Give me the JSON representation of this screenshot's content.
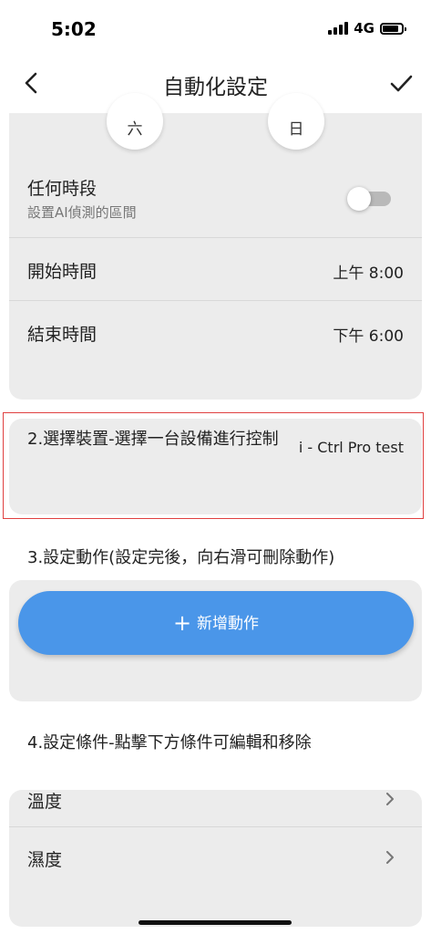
{
  "status_bar": {
    "time": "5:02",
    "network": "4G"
  },
  "nav": {
    "title": "自動化設定"
  },
  "days": {
    "sat": "六",
    "sun": "日"
  },
  "schedule": {
    "any_time_title": "任何時段",
    "any_time_subtitle": "設置AI偵測的區間",
    "any_time_enabled": false,
    "start_label": "開始時間",
    "start_value": "上午 8:00",
    "end_label": "結束時間",
    "end_value": "下午 6:00"
  },
  "device_section": {
    "title": "2.選擇裝置-選擇一台設備進行控制",
    "device_name": "i - Ctrl Pro test"
  },
  "actions_section": {
    "title": "3.設定動作(設定完後，向右滑可刪除動作)",
    "add_label": "新增動作"
  },
  "conditions_section": {
    "title": "4.設定條件-點擊下方條件可編輯和移除",
    "items": [
      "溫度",
      "濕度"
    ]
  },
  "colors": {
    "accent": "#4a96e9",
    "card": "#ececec",
    "highlight": "#e04040"
  }
}
